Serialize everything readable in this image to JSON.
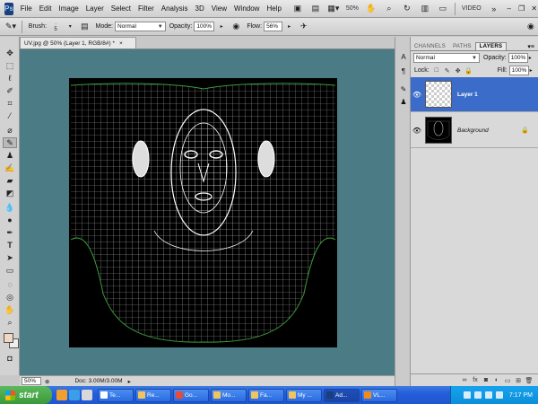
{
  "app": {
    "logo": "Ps"
  },
  "menubar": {
    "items": [
      "File",
      "Edit",
      "Image",
      "Layer",
      "Select",
      "Filter",
      "Analysis",
      "3D",
      "View",
      "Window",
      "Help"
    ],
    "zoom": "50%",
    "workspace": "VIDEO"
  },
  "options": {
    "brush_label": "Brush:",
    "brush_size": "5",
    "mode_label": "Mode:",
    "mode_value": "Normal",
    "opacity_label": "Opacity:",
    "opacity_value": "100%",
    "flow_label": "Flow:",
    "flow_value": "56%"
  },
  "document": {
    "tab_title": "UV.jpg @ 50% (Layer 1, RGB/8#) *",
    "zoom": "50%",
    "doc_size": "Doc: 3.00M/3.00M"
  },
  "layers_panel": {
    "tabs": [
      "CHANNELS",
      "PATHS",
      "LAYERS"
    ],
    "active_tab": "LAYERS",
    "blend_mode": "Normal",
    "opacity_label": "Opacity:",
    "opacity_value": "100%",
    "lock_label": "Lock:",
    "fill_label": "Fill:",
    "fill_value": "100%",
    "layers": [
      {
        "name": "Layer 1",
        "selected": true
      },
      {
        "name": "Background",
        "selected": false
      }
    ]
  },
  "taskbar": {
    "start_label": "start",
    "tasks": [
      "Te...",
      "Re...",
      "Go...",
      "Mo...",
      "Fa...",
      "My ...",
      "Ad...",
      "VL..."
    ],
    "active_task": "Ad...",
    "clock": "7:17 PM"
  },
  "colors": {
    "canvas_bg": "#4b7b84",
    "selection": "#3b6cc9",
    "taskbar": "#245edb"
  }
}
